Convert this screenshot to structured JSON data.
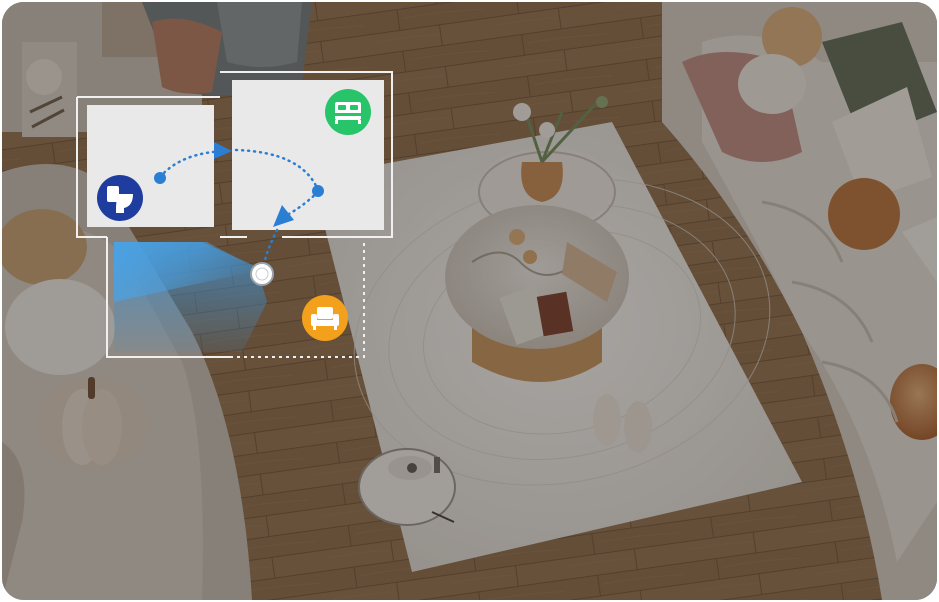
{
  "scene": {
    "description_free": true,
    "rooms": [
      {
        "id": "bathroom",
        "icon": "toilet-icon",
        "icon_color": "#1f3d9e"
      },
      {
        "id": "bedroom",
        "icon": "bed-icon",
        "icon_color": "#27c46a"
      },
      {
        "id": "living-room",
        "icon": "armchair-icon",
        "icon_color": "#f3a11c"
      }
    ],
    "colors": {
      "floor": "#8a6a4c",
      "overlay": "#2d2520",
      "room_fill": "#e9e9ea",
      "path": "#2a7fd4",
      "cleaning_zone": "#4aa3e6"
    },
    "robot_path": [
      "bathroom",
      "bedroom",
      "living-room"
    ]
  }
}
